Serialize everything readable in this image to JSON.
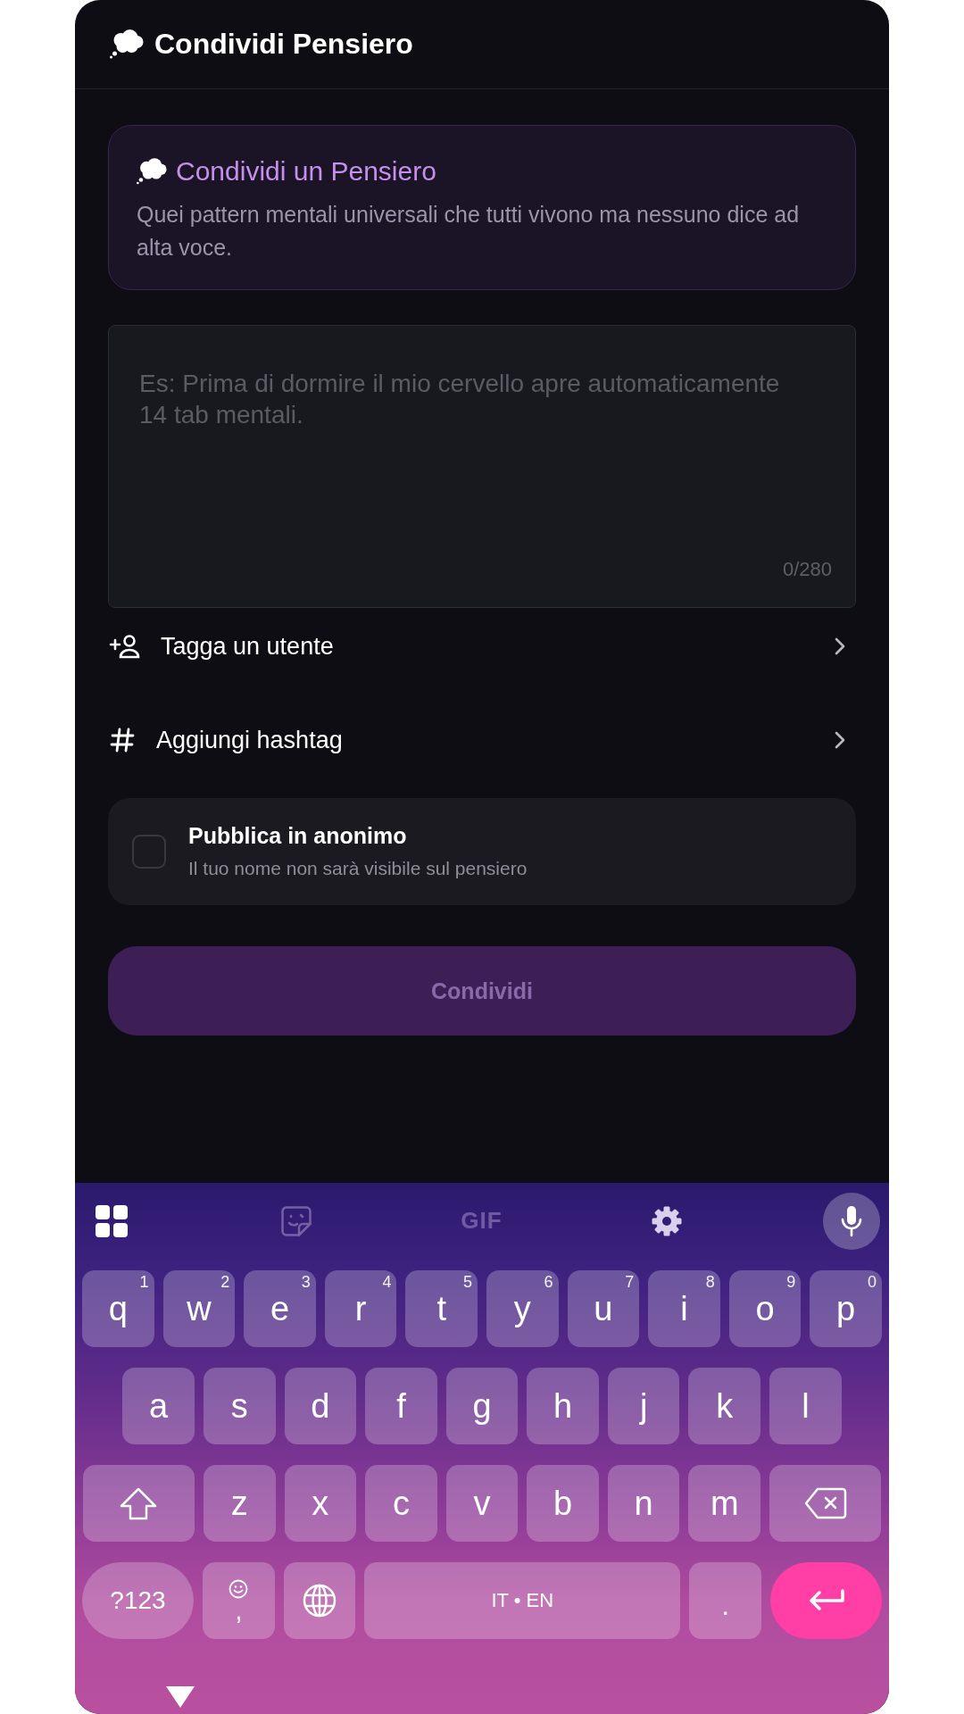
{
  "header": {
    "title": "Condividi Pensiero"
  },
  "intro_card": {
    "title": "Condividi un Pensiero",
    "description": "Quei pattern mentali universali che tutti vivono ma nessuno dice ad alta voce."
  },
  "thought_field": {
    "placeholder": "Es: Prima di dormire il mio cervello apre automaticamente 14 tab mentali.",
    "counter": "0/280"
  },
  "options": [
    {
      "kind": "tag_user",
      "label": "Tagga un utente"
    },
    {
      "kind": "hashtag",
      "label": "Aggiungi hashtag"
    }
  ],
  "anonymous_option": {
    "title": "Pubblica in anonimo",
    "subtitle": "Il tuo nome non sarà visibile sul pensiero",
    "checked": false
  },
  "submit_button": {
    "label": "Condividi",
    "disabled": true
  },
  "keyboard": {
    "toolbar": [
      {
        "kind": "apps",
        "disabled": false
      },
      {
        "kind": "sticker",
        "disabled": true
      },
      {
        "kind": "gif",
        "label": "GIF",
        "disabled": true
      },
      {
        "kind": "settings",
        "disabled": false
      },
      {
        "kind": "voice",
        "disabled": false
      }
    ],
    "rows": [
      {
        "keys": [
          {
            "kind": "letter",
            "label": "q",
            "hint": "1"
          },
          {
            "kind": "letter",
            "label": "w",
            "hint": "2"
          },
          {
            "kind": "letter",
            "label": "e",
            "hint": "3"
          },
          {
            "kind": "letter",
            "label": "r",
            "hint": "4"
          },
          {
            "kind": "letter",
            "label": "t",
            "hint": "5"
          },
          {
            "kind": "letter",
            "label": "y",
            "hint": "6"
          },
          {
            "kind": "letter",
            "label": "u",
            "hint": "7"
          },
          {
            "kind": "letter",
            "label": "i",
            "hint": "8"
          },
          {
            "kind": "letter",
            "label": "o",
            "hint": "9"
          },
          {
            "kind": "letter",
            "label": "p",
            "hint": "0"
          }
        ]
      },
      {
        "keys": [
          {
            "kind": "letter",
            "label": "a"
          },
          {
            "kind": "letter",
            "label": "s"
          },
          {
            "kind": "letter",
            "label": "d"
          },
          {
            "kind": "letter",
            "label": "f"
          },
          {
            "kind": "letter",
            "label": "g"
          },
          {
            "kind": "letter",
            "label": "h"
          },
          {
            "kind": "letter",
            "label": "j"
          },
          {
            "kind": "letter",
            "label": "k"
          },
          {
            "kind": "letter",
            "label": "l"
          }
        ]
      },
      {
        "keys": [
          {
            "kind": "shift"
          },
          {
            "kind": "letter",
            "label": "z"
          },
          {
            "kind": "letter",
            "label": "x"
          },
          {
            "kind": "letter",
            "label": "c"
          },
          {
            "kind": "letter",
            "label": "v"
          },
          {
            "kind": "letter",
            "label": "b"
          },
          {
            "kind": "letter",
            "label": "n"
          },
          {
            "kind": "letter",
            "label": "m"
          },
          {
            "kind": "backspace"
          }
        ]
      },
      {
        "keys": [
          {
            "kind": "symbols",
            "label": "?123"
          },
          {
            "kind": "comma",
            "label": ","
          },
          {
            "kind": "language"
          },
          {
            "kind": "space",
            "label": "IT • EN"
          },
          {
            "kind": "period",
            "label": "."
          },
          {
            "kind": "enter"
          }
        ]
      }
    ]
  }
}
